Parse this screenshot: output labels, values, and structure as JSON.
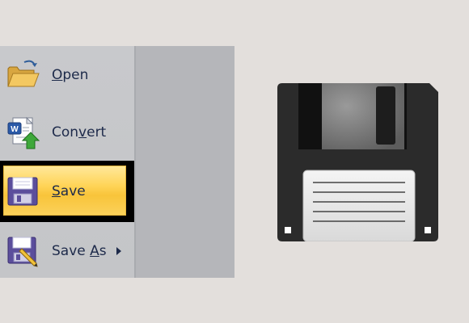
{
  "menu": {
    "items": [
      {
        "label_pre": "",
        "mnemonic": "O",
        "label_post": "pen",
        "icon": "folder-open-icon"
      },
      {
        "label_pre": "Con",
        "mnemonic": "v",
        "label_post": "ert",
        "icon": "convert-document-icon"
      },
      {
        "label_pre": "",
        "mnemonic": "S",
        "label_post": "ave",
        "icon": "save-disk-icon"
      },
      {
        "label_pre": "Save ",
        "mnemonic": "A",
        "label_post": "s",
        "icon": "save-as-icon"
      }
    ],
    "selected": "Save"
  },
  "illustration": {
    "icon": "floppy-disk-icon"
  },
  "colors": {
    "background": "#e3dfdc",
    "menu_bg": "#c8c9cc",
    "highlight": "#ffd457",
    "text": "#1d2a4a"
  }
}
